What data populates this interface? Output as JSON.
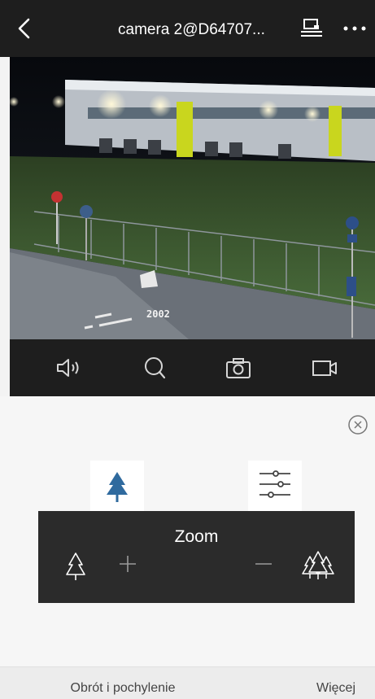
{
  "header": {
    "title": "camera 2@D64707...",
    "icons": [
      "back-arrow-icon",
      "monitor-icon",
      "more-icon"
    ]
  },
  "video": {
    "overlay_number": "2002"
  },
  "controls": {
    "icons": [
      "speaker-icon",
      "search-icon",
      "camera-icon",
      "video-record-icon"
    ]
  },
  "panel": {
    "tiles": [
      "tree-icon",
      "sliders-icon"
    ],
    "zoom_label": "Zoom",
    "zoom_buttons": [
      "single-tree-icon",
      "plus-icon",
      "minus-icon",
      "forest-icon"
    ]
  },
  "tabs": {
    "left": "Obrót i pochylenie",
    "right": "Więcej"
  },
  "colors": {
    "dark_bar": "#1e1e1e",
    "accent_blue": "#2f6a9e",
    "zoom_bg": "#2b2b2b"
  }
}
